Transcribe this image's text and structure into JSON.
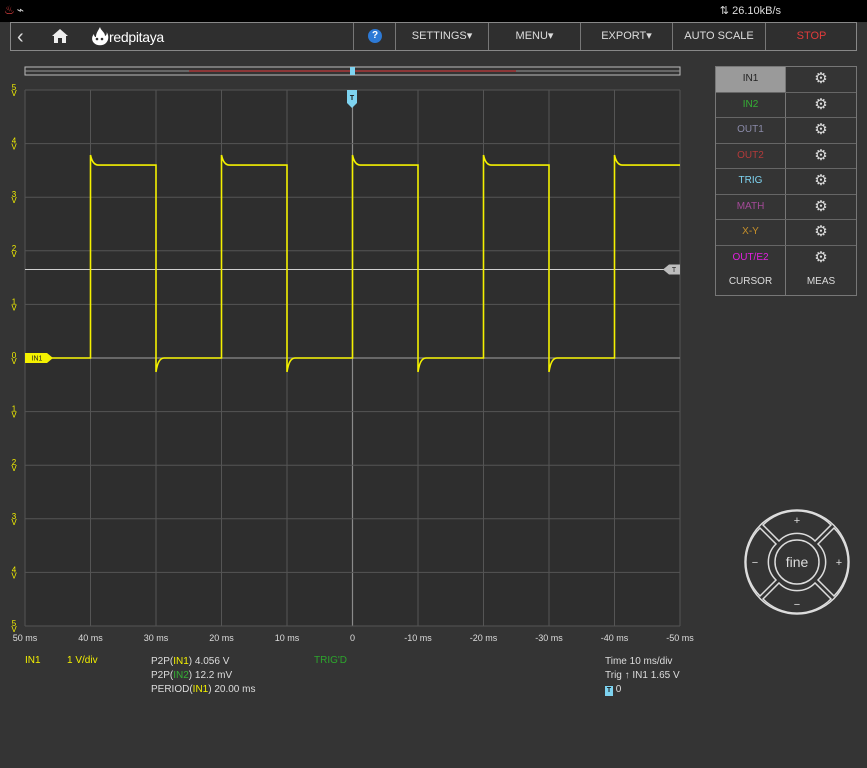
{
  "statusbar": {
    "rate": "26.10kB/s"
  },
  "logo": {
    "text": "redpitaya"
  },
  "toolbar": {
    "help": "?",
    "settings": "SETTINGS▾",
    "menu": "MENU▾",
    "export": "EXPORT▾",
    "autoscale": "AUTO SCALE",
    "stop": "STOP",
    "stop_color": "#e23b3b"
  },
  "channels": [
    {
      "label": "IN1",
      "color": "#222222",
      "active": true
    },
    {
      "label": "IN2",
      "color": "#35b034",
      "active": false
    },
    {
      "label": "OUT1",
      "color": "#8a8aa8",
      "active": false
    },
    {
      "label": "OUT2",
      "color": "#b43a3a",
      "active": false
    },
    {
      "label": "TRIG",
      "color": "#7ed3f0",
      "active": false
    },
    {
      "label": "MATH",
      "color": "#a44a98",
      "active": false
    },
    {
      "label": "X-Y",
      "color": "#c8912a",
      "active": false
    },
    {
      "label": "OUT/E2",
      "color": "#e21fe0",
      "active": false
    }
  ],
  "panel": {
    "cursor": "CURSOR",
    "meas": "MEAS"
  },
  "jog": {
    "center": "fine",
    "up": "+",
    "down": "−",
    "left": "−",
    "right": "+"
  },
  "plot": {
    "trigger_marker": "T",
    "trigger_level_marker": "T",
    "channel_marker": "IN1",
    "trace_color": "#f4f100",
    "trigger_line_color": "#cfcfcf"
  },
  "chart_data": {
    "type": "line",
    "title": "",
    "xlabel": "",
    "ylabel": "",
    "x_ticks": [
      "50 ms",
      "40 ms",
      "30 ms",
      "20 ms",
      "10 ms",
      "0",
      "-10 ms",
      "-20 ms",
      "-30 ms",
      "-40 ms",
      "-50 ms"
    ],
    "y_ticks": [
      "5",
      "4",
      "3",
      "2",
      "1",
      "0",
      "1",
      "2",
      "3",
      "4",
      "5"
    ],
    "y_unit": "V",
    "xlim": [
      50,
      -50
    ],
    "ylim": [
      -5,
      5
    ],
    "trigger_level": 1.65,
    "series": [
      {
        "name": "IN1",
        "x": [
          50,
          40,
          40,
          30,
          30,
          20,
          20,
          10,
          10,
          0,
          0,
          -10,
          -10,
          -20,
          -20,
          -30,
          -30,
          -40,
          -40,
          -50
        ],
        "y": [
          0,
          0,
          3.6,
          3.6,
          0,
          0,
          3.6,
          3.6,
          0,
          0,
          3.6,
          3.6,
          0,
          0,
          3.6,
          3.6,
          0,
          0,
          3.6,
          3.6
        ]
      }
    ]
  },
  "readouts": {
    "channel": "IN1",
    "scale": "1 V/div",
    "p2p1_prefix": "P2P(",
    "p2p1_ch": "IN1",
    "p2p1_suffix": ") 4.056 V",
    "p2p2_prefix": "P2P(",
    "p2p2_ch": "IN2",
    "p2p2_suffix": ") 12.2 mV",
    "period_prefix": "PERIOD(",
    "period_ch": "IN1",
    "period_suffix": ") 20.00 ms",
    "trig_state": "TRIG'D",
    "time": "Time 10 ms/div",
    "trig": "Trig ↑ IN1 1.65 V",
    "trig_badge": "T",
    "trig_offset": "0"
  }
}
